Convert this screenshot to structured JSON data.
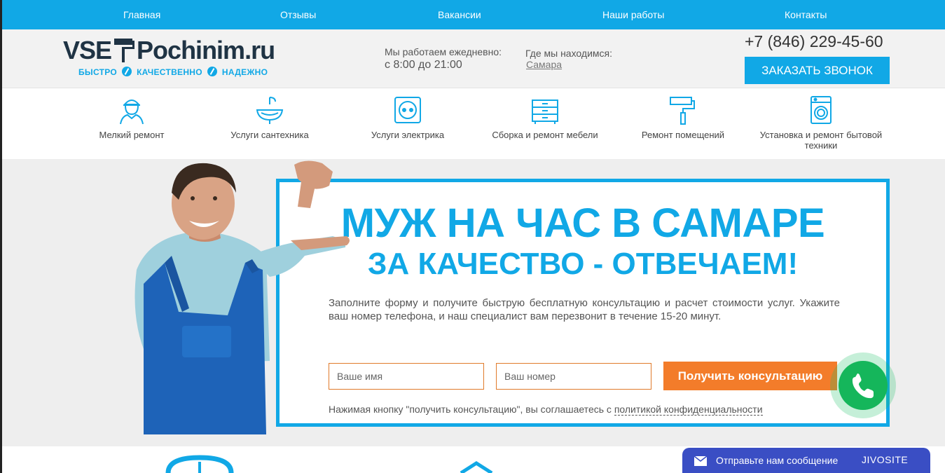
{
  "nav": {
    "items": [
      "Главная",
      "Отзывы",
      "Вакансии",
      "Наши работы",
      "Контакты"
    ]
  },
  "header": {
    "logo_left": "VSE",
    "logo_right": "Pochinim.ru",
    "tagline": [
      "БЫСТРО",
      "КАЧЕСТВЕННО",
      "НАДЕЖНО"
    ],
    "hours_label": "Мы работаем ежедневно:",
    "hours_value": "с 8:00 до 21:00",
    "location_label": "Где мы находимся:",
    "location_city": "Самара",
    "phone": "+7 (846) 229-45-60",
    "callback_button": "ЗАКАЗАТЬ ЗВОНОК"
  },
  "services": [
    {
      "label": "Мелкий ремонт",
      "icon": "worker-icon"
    },
    {
      "label": "Услуги сантехника",
      "icon": "sink-icon"
    },
    {
      "label": "Услуги электрика",
      "icon": "socket-icon"
    },
    {
      "label": "Сборка и ремонт мебели",
      "icon": "dresser-icon"
    },
    {
      "label": "Ремонт помещений",
      "icon": "paint-roller-icon"
    },
    {
      "label": "Установка и ремонт бытовой техники",
      "icon": "washing-machine-icon"
    }
  ],
  "hero": {
    "title": "МУЖ НА ЧАС В САМАРЕ",
    "subtitle": "ЗА КАЧЕСТВО - ОТВЕЧАЕМ!",
    "description": "Заполните форму и получите быструю бесплатную консультацию и расчет стоимости услуг. Укажите ваш номер телефона, и наш специалист вам перезвонит в течение 15-20 минут.",
    "name_placeholder": "Ваше имя",
    "phone_placeholder": "Ваш номер",
    "submit_button": "Получить консультацию",
    "consent_text": "Нажимая кнопку \"получить консультацию\", вы соглашаетесь с",
    "consent_link": "политикой конфиденциальности"
  },
  "chat": {
    "message": "Отправьте нам сообщение",
    "brand": "JIVOSITE"
  },
  "colors": {
    "accent": "#11a8e6",
    "cta": "#f37c2a",
    "call": "#15b65b",
    "chat": "#3a4ec4"
  }
}
